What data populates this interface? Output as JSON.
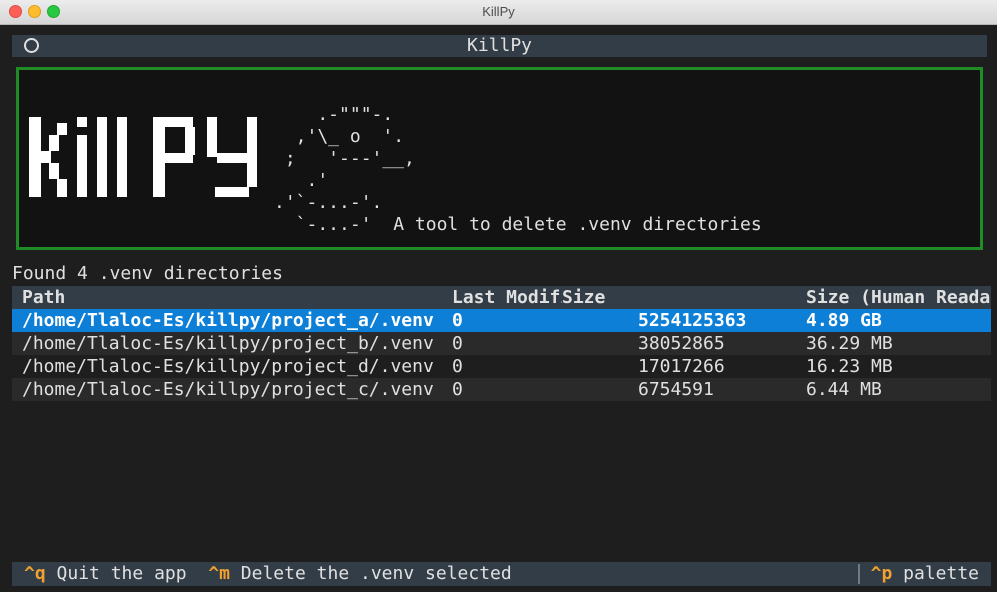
{
  "window": {
    "title": "KillPy"
  },
  "app": {
    "header_title": "KillPy"
  },
  "banner": {
    "logo_text": "KillPy",
    "ascii_art": "    .-\"\"\"-.\n  ,'\\_ o  '.\n ;   '---'__,\n   .'   \n.'`-...-'.\n  `-...-' ",
    "tagline": "A tool to delete .venv directories"
  },
  "status": {
    "found_text": "Found 4 .venv directories"
  },
  "table": {
    "columns": [
      "Path",
      "Last Modified",
      "Size",
      "Size (Human Readable)"
    ],
    "rows": [
      {
        "path": "/home/Tlaloc-Es/killpy/project_a/.venv",
        "modified": "0",
        "size": "5254125363",
        "human": "4.89 GB",
        "selected": true
      },
      {
        "path": "/home/Tlaloc-Es/killpy/project_b/.venv",
        "modified": "0",
        "size": "38052865",
        "human": "36.29 MB",
        "selected": false
      },
      {
        "path": "/home/Tlaloc-Es/killpy/project_d/.venv",
        "modified": "0",
        "size": "17017266",
        "human": "16.23 MB",
        "selected": false
      },
      {
        "path": "/home/Tlaloc-Es/killpy/project_c/.venv",
        "modified": "0",
        "size": "6754591",
        "human": "6.44 MB",
        "selected": false
      }
    ]
  },
  "footer": {
    "bindings": [
      {
        "key": "^q",
        "label": "Quit the app"
      },
      {
        "key": "^m",
        "label": "Delete the .venv selected"
      }
    ],
    "palette": {
      "key": "^p",
      "label": "palette"
    }
  },
  "colors": {
    "accent_selected": "#0d7fd6",
    "banner_border": "#1f8c26",
    "key_highlight": "#f0a030",
    "header_bg": "#323d47"
  }
}
